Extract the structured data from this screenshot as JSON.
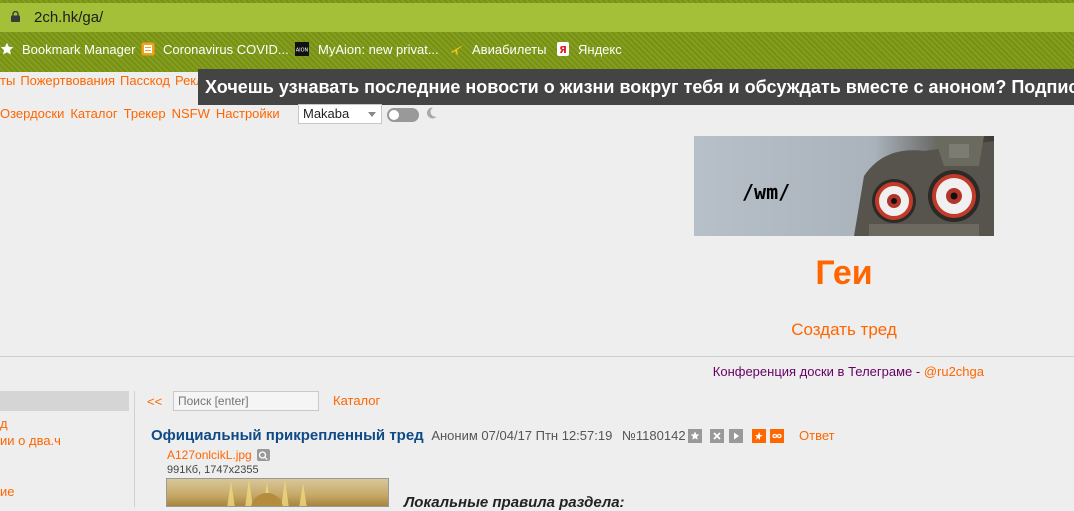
{
  "browser": {
    "url": "2ch.hk/ga/",
    "bookmarks": [
      {
        "label": "Bookmark Manager",
        "icon": "star-icon"
      },
      {
        "label": "Coronavirus COVID...",
        "icon": "news-icon"
      },
      {
        "label": "MyAion: new privat...",
        "icon": "aion-icon"
      },
      {
        "label": "Авиабилеты",
        "icon": "plane-icon"
      },
      {
        "label": "Яндекс",
        "icon": "yandex-icon"
      }
    ]
  },
  "topnav": {
    "items": [
      "ты",
      "Пожертвования",
      "Пасскод",
      "Реклама",
      "[ ]"
    ]
  },
  "marquee": {
    "text": "Хочешь узнавать последние новости о жизни вокруг тебя и обсуждать вместе с аноном? Подписыв"
  },
  "subnav": {
    "items": [
      "Озердоски",
      "Каталог",
      "Трекер",
      "NSFW",
      "Настройки"
    ],
    "style_select": "Makaba"
  },
  "banner": {
    "text": "/wm/"
  },
  "board": {
    "title": "Геи",
    "create_thread": "Создать тред",
    "conference": "Конференция доски в Телеграме - ",
    "telegram": "@ru2chga"
  },
  "sidebar": {
    "items": [
      "д",
      "ии о два.ч",
      "ие",
      ""
    ]
  },
  "toolbar": {
    "back": "<<",
    "search_placeholder": "Поиск [enter]",
    "catalog": "Каталог"
  },
  "post": {
    "subject": "Официальный прикрепленный тред",
    "author": "Аноним",
    "datetime": "07/04/17 Птн 12:57:19",
    "number": "№1180142",
    "reply": "Ответ",
    "filename": "A127onlcikL.jpg",
    "fileinfo": "991Кб, 1747x2355",
    "body_title": "Локальные правила раздела:"
  },
  "colors": {
    "accent": "#ff6600",
    "subject": "#0f4a86",
    "marquee_bg": "#444444",
    "chrome_bg": "#7f9a16"
  }
}
